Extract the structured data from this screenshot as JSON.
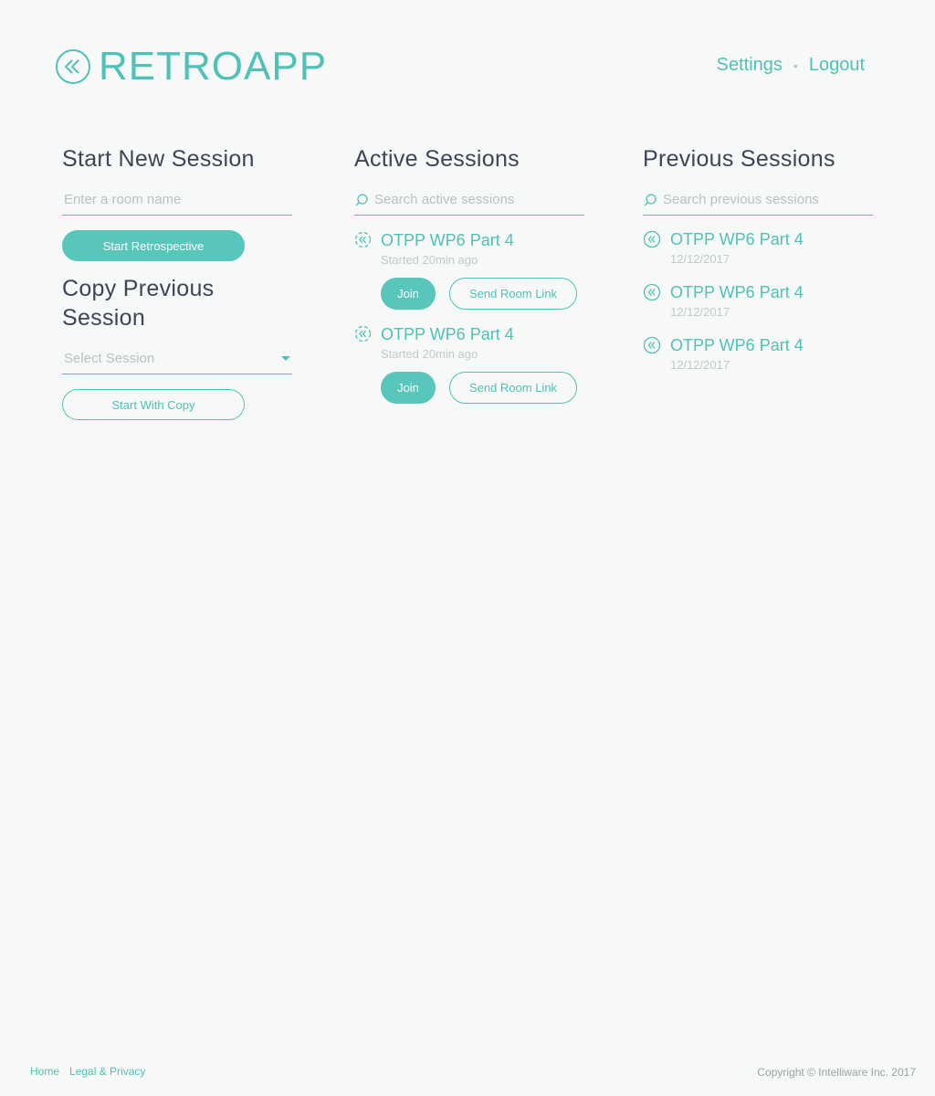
{
  "brand": {
    "name": "RETROAPP",
    "logo_icon": "rewind-circle-icon",
    "accent_color": "#4fc1b6"
  },
  "nav": {
    "settings": "Settings",
    "separator": "•",
    "logout": "Logout"
  },
  "new_session": {
    "title": "Start New Session",
    "room_placeholder": "Enter a room name",
    "start_button": "Start Retrospective"
  },
  "copy_session": {
    "title": "Copy Previous Session",
    "select_value": "Select Session",
    "start_button": "Start With Copy"
  },
  "active_sessions": {
    "title": "Active Sessions",
    "search_placeholder": "Search active sessions",
    "items": [
      {
        "name": "OTPP WP6 Part 4",
        "status": "Started 20min ago",
        "join": "Join",
        "send_link": "Send Room Link"
      },
      {
        "name": "OTPP WP6 Part 4",
        "status": "Started 20min ago",
        "join": "Join",
        "send_link": "Send Room Link"
      }
    ]
  },
  "previous_sessions": {
    "title": "Previous Sessions",
    "search_placeholder": "Search previous sessions",
    "items": [
      {
        "name": "OTPP WP6 Part 4",
        "date": "12/12/2017"
      },
      {
        "name": "OTPP WP6 Part 4",
        "date": "12/12/2017"
      },
      {
        "name": "OTPP WP6 Part 4",
        "date": "12/12/2017"
      }
    ]
  },
  "footer": {
    "home": "Home",
    "legal": "Legal & Privacy",
    "copyright": "Copyright © Intelliware Inc. 2017"
  }
}
